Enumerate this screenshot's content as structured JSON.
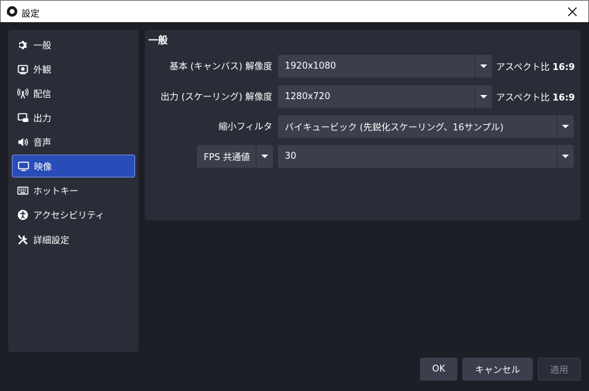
{
  "window": {
    "title": "設定"
  },
  "sidebar": {
    "items": [
      {
        "label": "一般",
        "icon": "gear-icon"
      },
      {
        "label": "外観",
        "icon": "appearance-icon"
      },
      {
        "label": "配信",
        "icon": "broadcast-icon"
      },
      {
        "label": "出力",
        "icon": "output-icon"
      },
      {
        "label": "音声",
        "icon": "speaker-icon"
      },
      {
        "label": "映像",
        "icon": "monitor-icon"
      },
      {
        "label": "ホットキー",
        "icon": "keyboard-icon"
      },
      {
        "label": "アクセシビリティ",
        "icon": "accessibility-icon"
      },
      {
        "label": "詳細設定",
        "icon": "tools-icon"
      }
    ],
    "active_index": 5
  },
  "panel": {
    "title": "一般",
    "base_resolution": {
      "label": "基本 (キャンバス) 解像度",
      "value": "1920x1080",
      "aspect_prefix": "アスペクト比",
      "aspect_value": "16:9"
    },
    "output_resolution": {
      "label": "出力 (スケーリング) 解像度",
      "value": "1280x720",
      "aspect_prefix": "アスペクト比",
      "aspect_value": "16:9"
    },
    "downscale_filter": {
      "label": "縮小フィルタ",
      "value": "バイキュービック (先鋭化スケーリング、16サンプル)"
    },
    "fps": {
      "type_value": "FPS 共通値",
      "value": "30"
    }
  },
  "buttons": {
    "ok": "OK",
    "cancel": "キャンセル",
    "apply": "適用"
  },
  "colors": {
    "accent": "#284cb8",
    "panel": "#2a2d37",
    "field": "#3b3e4b",
    "background": "#1d1f26"
  }
}
